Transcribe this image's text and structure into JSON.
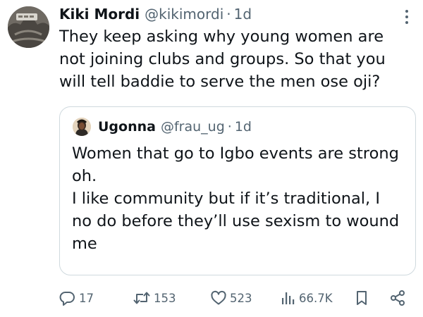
{
  "tweet": {
    "author": {
      "name": "Kiki Mordi",
      "handle": "@kikimordi",
      "time": "1d",
      "separator": "·"
    },
    "text": "They keep asking why young women are not joining clubs and groups. So that you will tell baddie to serve the men ose oji?",
    "quoted": {
      "author": {
        "name": "Ugonna",
        "handle": "@frau_ug",
        "time": "1d",
        "separator": "·"
      },
      "text": "Women that go to Igbo events are strong oh.\nI like community but if it’s traditional, I no do before they’ll use sexism to wound me"
    },
    "actions": {
      "replies": "17",
      "reposts": "153",
      "likes": "523",
      "views": "66.7K"
    }
  },
  "colors": {
    "text": "#0f1419",
    "secondary": "#536471",
    "border": "#cfd9de",
    "icon": "#536471"
  },
  "icons": {
    "more": "more-vertical-icon",
    "reply": "reply-icon",
    "repost": "repost-icon",
    "like": "heart-icon",
    "views": "views-icon",
    "bookmark": "bookmark-icon",
    "share": "share-icon"
  }
}
